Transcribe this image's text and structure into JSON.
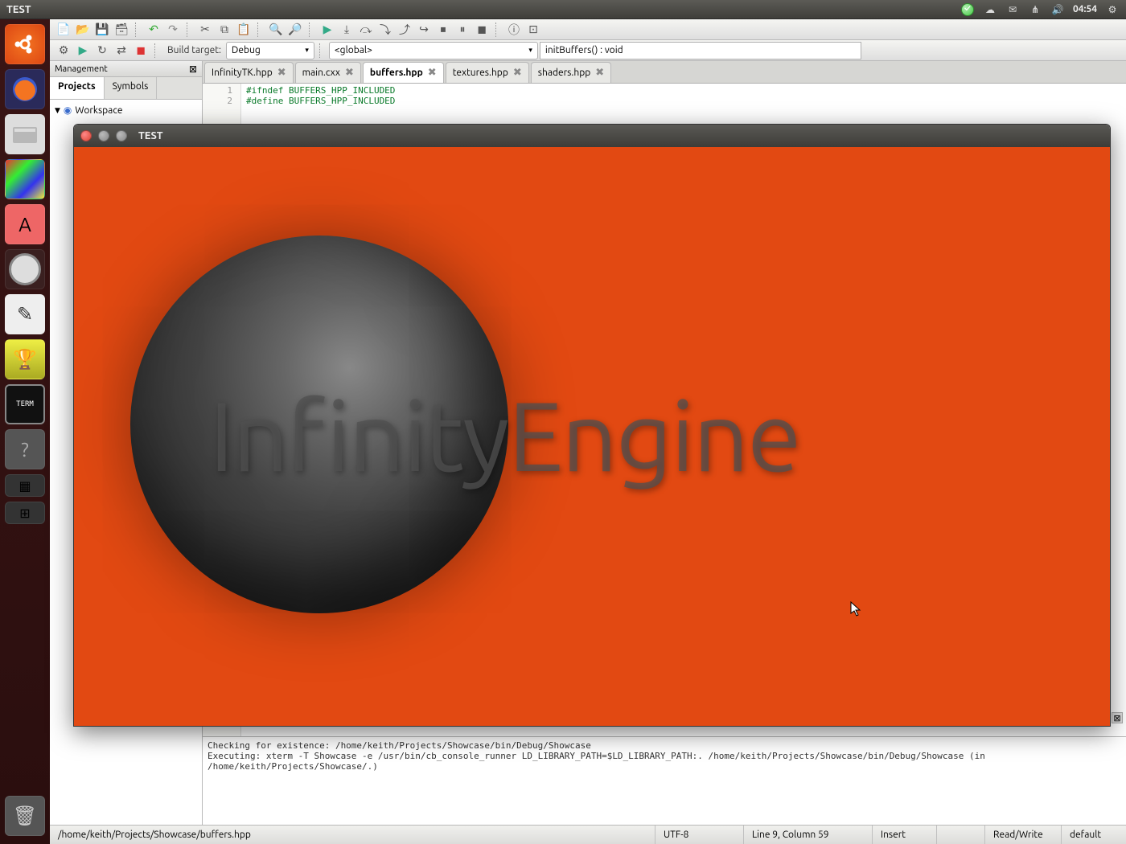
{
  "top_panel": {
    "title": "TEST",
    "time": "04:54"
  },
  "toolbar2": {
    "build_target_label": "Build target:",
    "build_target_value": "Debug",
    "scope_value": "<global>",
    "function_value": "initBuffers() : void"
  },
  "management": {
    "title": "Management",
    "tabs": [
      "Projects",
      "Symbols"
    ],
    "active_tab": 0,
    "tree_root": "Workspace"
  },
  "editor_tabs": [
    {
      "label": "InfinityTK.hpp",
      "active": false
    },
    {
      "label": "main.cxx",
      "active": false
    },
    {
      "label": "buffers.hpp",
      "active": true
    },
    {
      "label": "textures.hpp",
      "active": false
    },
    {
      "label": "shaders.hpp",
      "active": false
    }
  ],
  "code": {
    "lines": [
      {
        "num": "1",
        "text": "#ifndef BUFFERS_HPP_INCLUDED"
      },
      {
        "num": "2",
        "text": "#define BUFFERS_HPP_INCLUDED"
      }
    ]
  },
  "log": [
    "Checking for existence: /home/keith/Projects/Showcase/bin/Debug/Showcase",
    "Executing: xterm -T Showcase -e /usr/bin/cb_console_runner LD_LIBRARY_PATH=$LD_LIBRARY_PATH:. /home/keith/Projects/Showcase/bin/Debug/Showcase  (in /home/keith/Projects/Showcase/.)"
  ],
  "status": {
    "path": "/home/keith/Projects/Showcase/buffers.hpp",
    "encoding": "UTF-8",
    "position": "Line 9, Column 59",
    "mode": "Insert",
    "access": "Read/Write",
    "profile": "default"
  },
  "app_window": {
    "title": "TEST",
    "logo_text": "InfinityEngine"
  },
  "colors": {
    "accent": "#dd4814",
    "app_bg": "#e24912"
  }
}
